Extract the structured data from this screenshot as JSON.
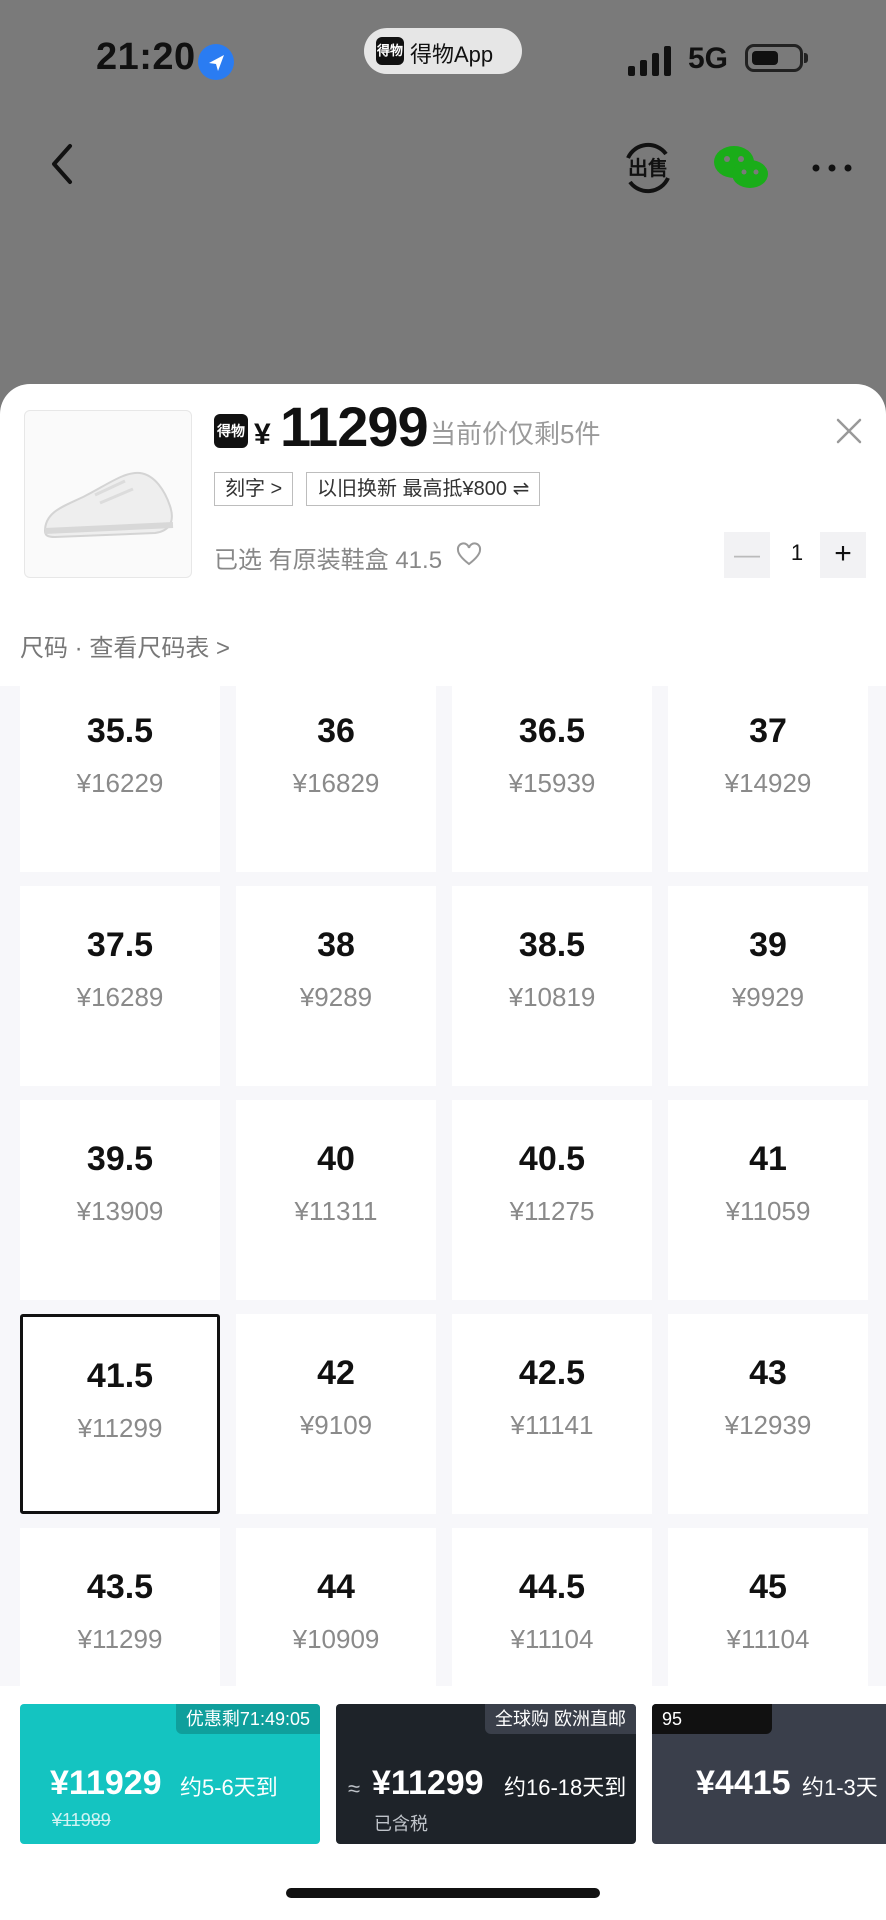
{
  "status_bar": {
    "time": "21:20",
    "app_pill": "得物App",
    "app_logo": "得物",
    "network": "5G"
  },
  "nav": {
    "back_icon": "chevron-left-icon",
    "sell_icon": "sell-icon",
    "wechat_icon": "wechat-icon",
    "more_icon": "more-icon"
  },
  "product": {
    "brand_logo": "得物",
    "currency": "¥",
    "price": "11299",
    "price_note": "当前价仅剩5件",
    "tag_engrave": "刻字 >",
    "tag_tradein": "以旧换新 最高抵¥800 ⇌",
    "selected_text": "已选 有原装鞋盒 41.5",
    "quantity": "1"
  },
  "size_header": "尺码 · 查看尺码表 >",
  "sizes": [
    {
      "size": "35.5",
      "price": "¥16229"
    },
    {
      "size": "36",
      "price": "¥16829"
    },
    {
      "size": "36.5",
      "price": "¥15939"
    },
    {
      "size": "37",
      "price": "¥14929"
    },
    {
      "size": "37.5",
      "price": "¥16289"
    },
    {
      "size": "38",
      "price": "¥9289"
    },
    {
      "size": "38.5",
      "price": "¥10819"
    },
    {
      "size": "39",
      "price": "¥9929"
    },
    {
      "size": "39.5",
      "price": "¥13909"
    },
    {
      "size": "40",
      "price": "¥11311"
    },
    {
      "size": "40.5",
      "price": "¥11275"
    },
    {
      "size": "41",
      "price": "¥11059"
    },
    {
      "size": "41.5",
      "price": "¥11299",
      "selected": true
    },
    {
      "size": "42",
      "price": "¥9109"
    },
    {
      "size": "42.5",
      "price": "¥11141"
    },
    {
      "size": "43",
      "price": "¥12939"
    },
    {
      "size": "43.5",
      "price": "¥11299"
    },
    {
      "size": "44",
      "price": "¥10909"
    },
    {
      "size": "44.5",
      "price": "¥11104"
    },
    {
      "size": "45",
      "price": "¥11104"
    }
  ],
  "offers": [
    {
      "badge": "优惠剩71:49:05",
      "price": "¥11929",
      "eta": "约5-6天到",
      "old_price": "¥11989"
    },
    {
      "badge": "全球购 欧洲直邮",
      "approx": "≈",
      "price": "¥11299",
      "eta": "约16-18天到",
      "tax": "已含税"
    },
    {
      "badge": "95",
      "price": "¥4415",
      "eta": "约1-3天"
    }
  ]
}
